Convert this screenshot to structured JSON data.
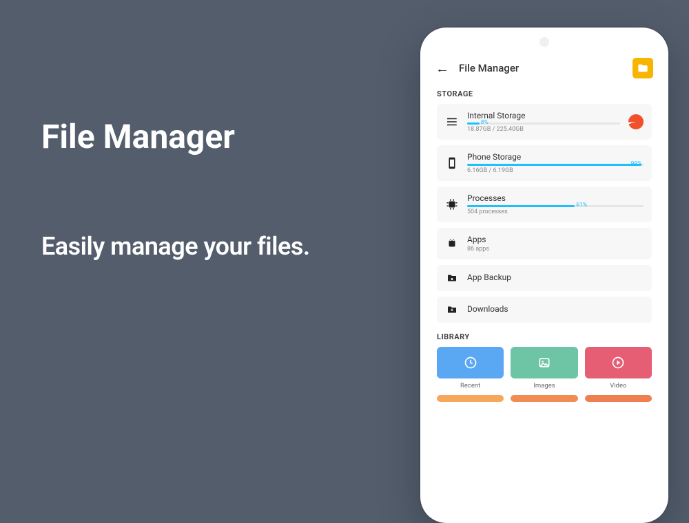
{
  "hero": {
    "title": "File Manager",
    "subtitle": "Easily manage your files."
  },
  "appbar": {
    "title": "File Manager"
  },
  "sections": {
    "storage_label": "STORAGE",
    "library_label": "LIBRARY"
  },
  "storage": {
    "internal": {
      "name": "Internal Storage",
      "percent": "8%",
      "percent_num": 8,
      "sub": "18.87GB / 225.40GB"
    },
    "phone": {
      "name": "Phone Storage",
      "percent": "99%",
      "percent_num": 99,
      "sub": "6.16GB / 6.19GB"
    },
    "processes": {
      "name": "Processes",
      "percent": "61%",
      "percent_num": 61,
      "sub": "504 processes"
    },
    "apps": {
      "name": "Apps",
      "sub": "86 apps"
    },
    "backup": {
      "name": "App Backup"
    },
    "downloads": {
      "name": "Downloads"
    }
  },
  "library": [
    {
      "name": "Recent",
      "color": "#5aa8f4"
    },
    {
      "name": "Images",
      "color": "#6dc5a6"
    },
    {
      "name": "Video",
      "color": "#e65e74"
    }
  ],
  "library_row2_colors": [
    "#f5a75b",
    "#f28c55",
    "#ef7e50"
  ]
}
